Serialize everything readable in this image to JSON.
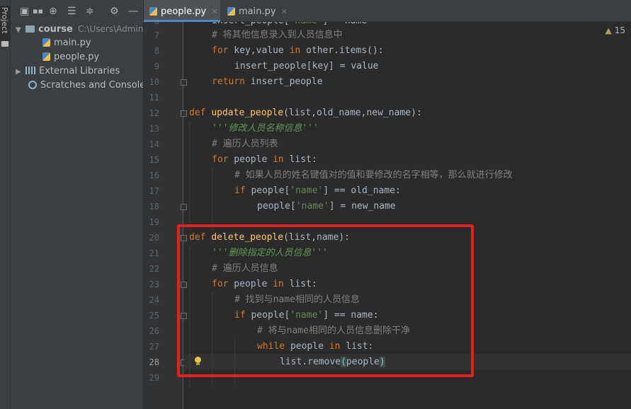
{
  "left_strip": {
    "label": "Project"
  },
  "project_panel": {
    "toolbar_icons": [
      "project-icon",
      "dropdown-icon",
      "locate-icon",
      "expand-all-icon",
      "collapse-all-icon",
      "settings-icon",
      "hide-icon"
    ],
    "tree": [
      {
        "label": "course",
        "path": "C:\\Users\\Adminis",
        "type": "folder",
        "expanded": true
      },
      {
        "label": "main.py",
        "type": "python-file"
      },
      {
        "label": "people.py",
        "type": "python-file"
      },
      {
        "label": "External Libraries",
        "type": "libraries",
        "expanded": false
      },
      {
        "label": "Scratches and Consoles",
        "type": "scratches"
      }
    ]
  },
  "tabs": [
    {
      "label": "people.py",
      "active": true
    },
    {
      "label": "main.py",
      "active": false
    }
  ],
  "editor": {
    "warning_count": "15",
    "current_line": "28",
    "lines": [
      {
        "n": "6",
        "text": "insert_people['name'] = name"
      },
      {
        "n": "7",
        "text": "# 将其他信息录入到人员信息中"
      },
      {
        "n": "8",
        "text": "for key,value in other.items():"
      },
      {
        "n": "9",
        "text": "insert_people[key] = value"
      },
      {
        "n": "10",
        "text": "return insert_people"
      },
      {
        "n": "11",
        "text": ""
      },
      {
        "n": "12",
        "text": "def update_people(list,old_name,new_name):"
      },
      {
        "n": "13",
        "text": "'''修改人员名称信息'''"
      },
      {
        "n": "14",
        "text": "# 遍历人员列表"
      },
      {
        "n": "15",
        "text": "for people in list:"
      },
      {
        "n": "16",
        "text": "# 如果人员的姓名键值对的值和要修改的名字相等，那么就进行修改"
      },
      {
        "n": "17",
        "text": "if people['name'] == old_name:"
      },
      {
        "n": "18",
        "text": "people['name'] = new_name"
      },
      {
        "n": "19",
        "text": ""
      },
      {
        "n": "20",
        "text": "def delete_people(list,name):"
      },
      {
        "n": "21",
        "text": "'''删除指定的人员信息'''"
      },
      {
        "n": "22",
        "text": "# 遍历人员信息"
      },
      {
        "n": "23",
        "text": "for people in list:"
      },
      {
        "n": "24",
        "text": "# 找到与name相同的人员信息"
      },
      {
        "n": "25",
        "text": "if people['name'] == name:"
      },
      {
        "n": "26",
        "text": "# 将与name相同的人员信息删除干净"
      },
      {
        "n": "27",
        "text": "while people in list:"
      },
      {
        "n": "28",
        "text": "list.remove(people)"
      },
      {
        "n": "29",
        "text": ""
      }
    ]
  },
  "colors": {
    "keyword": "#cc7832",
    "function": "#ffc66d",
    "comment": "#808080",
    "string": "#6a8759",
    "docstring": "#629755",
    "annotation_box": "#e52020"
  }
}
